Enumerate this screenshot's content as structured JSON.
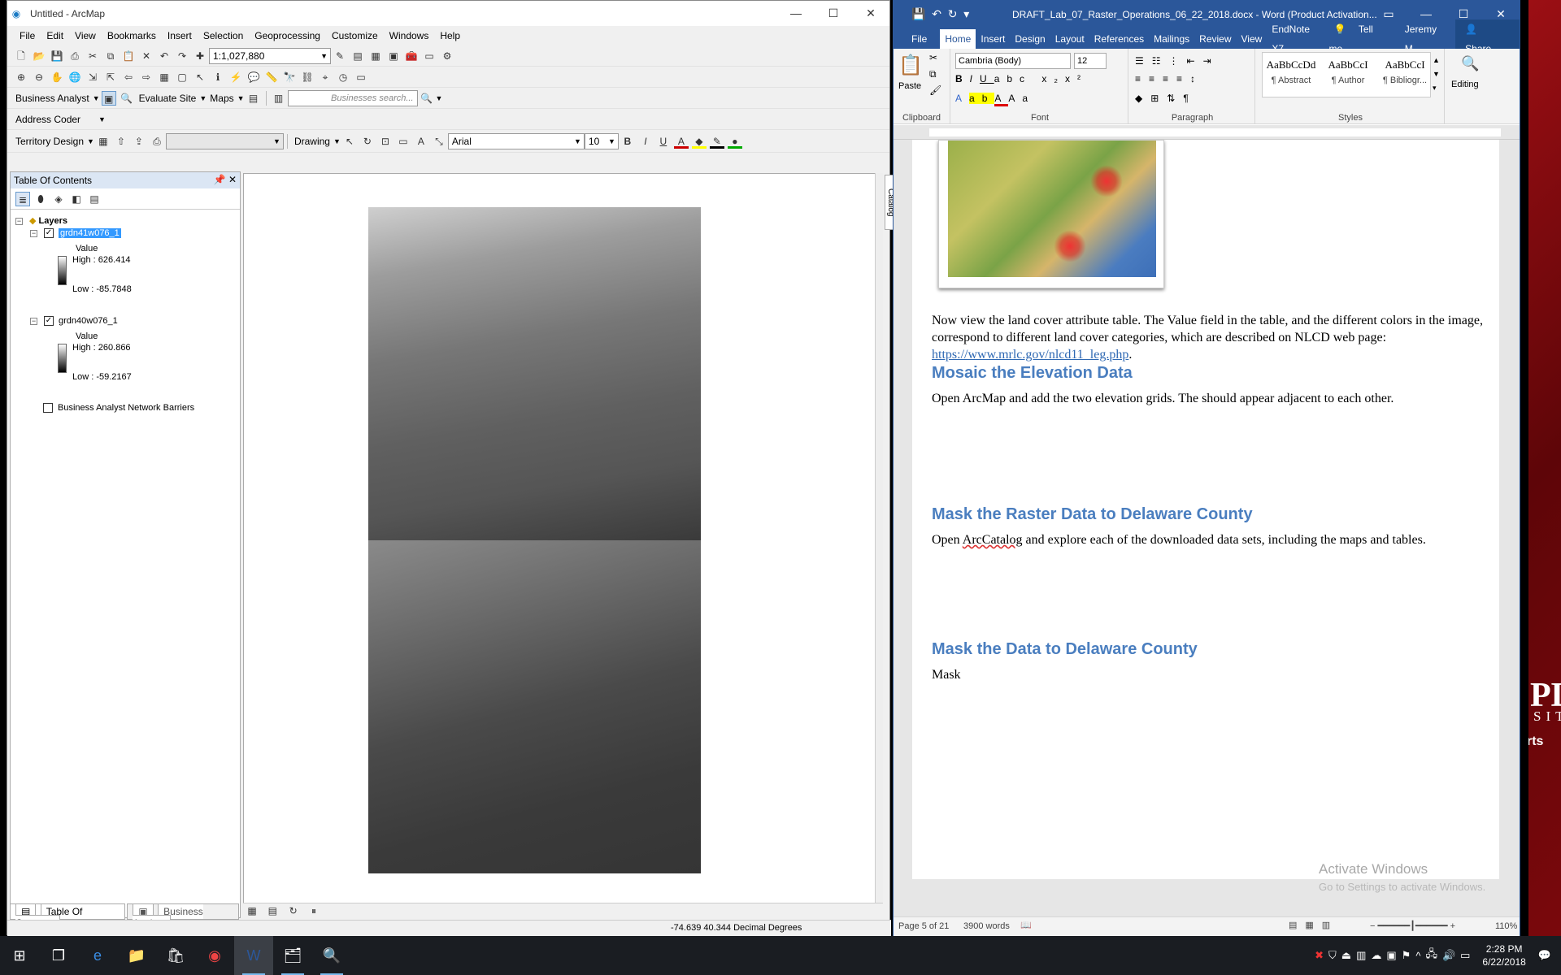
{
  "arcmap": {
    "title": "Untitled - ArcMap",
    "menu": [
      "File",
      "Edit",
      "View",
      "Bookmarks",
      "Insert",
      "Selection",
      "Geoprocessing",
      "Customize",
      "Windows",
      "Help"
    ],
    "scale": "1:1,027,880",
    "business_analyst": "Business Analyst",
    "evaluate_site": "Evaluate Site",
    "maps": "Maps",
    "search_placeholder": "Businesses search...",
    "address_coder": "Address Coder",
    "territory_design": "Territory Design",
    "drawing": "Drawing",
    "font": "Arial",
    "font_size": "10",
    "toc": {
      "title": "Table Of Contents",
      "layers_label": "Layers",
      "layer1": {
        "name": "grdn41w076_1",
        "value_label": "Value",
        "high": "High : 626.414",
        "low": "Low : -85.7848"
      },
      "layer2": {
        "name": "grdn40w076_1",
        "value_label": "Value",
        "high": "High : 260.866",
        "low": "Low : -59.2167"
      },
      "layer3": {
        "name": "Business Analyst Network Barriers"
      },
      "tab_toc": "Table Of Contents",
      "tab_ba": "Business Analyst"
    },
    "catalog": "Catalog",
    "coords": "-74.639  40.344 Decimal Degrees"
  },
  "word": {
    "title": "DRAFT_Lab_07_Raster_Operations_06_22_2018.docx - Word (Product Activation...",
    "tabs": [
      "File",
      "Home",
      "Insert",
      "Design",
      "Layout",
      "References",
      "Mailings",
      "Review",
      "View",
      "EndNote X7"
    ],
    "tell_me": "Tell me...",
    "user": "Jeremy M...",
    "share": "Share",
    "font": "Cambria (Body)",
    "size": "12",
    "paste": "Paste",
    "groups": {
      "clipboard": "Clipboard",
      "font": "Font",
      "paragraph": "Paragraph",
      "styles": "Styles",
      "editing": "Editing"
    },
    "styles": [
      {
        "preview": "AaBbCcDd",
        "name": "¶ Abstract"
      },
      {
        "preview": "AaBbCcI",
        "name": "¶ Author"
      },
      {
        "preview": "AaBbCcI",
        "name": "¶ Bibliogr..."
      }
    ],
    "para1_a": "Now view the land cover attribute table.  The Value field in the table, and the different colors in the image, correspond to different land cover categories, which are described on NLCD web page: ",
    "para1_link": "https://www.mrlc.gov/nlcd11_leg.php",
    "para1_end": ".",
    "head1": "Mosaic the Elevation Data",
    "para2": "Open ArcMap and add the two elevation grids.  The should appear adjacent to each other.",
    "head2": "Mask the Raster Data to Delaware County",
    "para3_a": "Open ",
    "para3_squig": "ArcCatalog",
    "para3_b": " and explore each of the downloaded data sets, including the maps and tables.",
    "head3": "Mask the Data to Delaware County",
    "para4": "Mask",
    "activate": "Activate Windows",
    "activate2": "Go to Settings to activate Windows.",
    "page_info": "Page 5 of 21",
    "words": "3900 words",
    "zoom": "110%"
  },
  "wallpaper_text": {
    "a": "PL",
    "b": "SIT",
    "c": "rts"
  },
  "taskbar": {
    "time": "2:28 PM",
    "date": "6/22/2018"
  }
}
